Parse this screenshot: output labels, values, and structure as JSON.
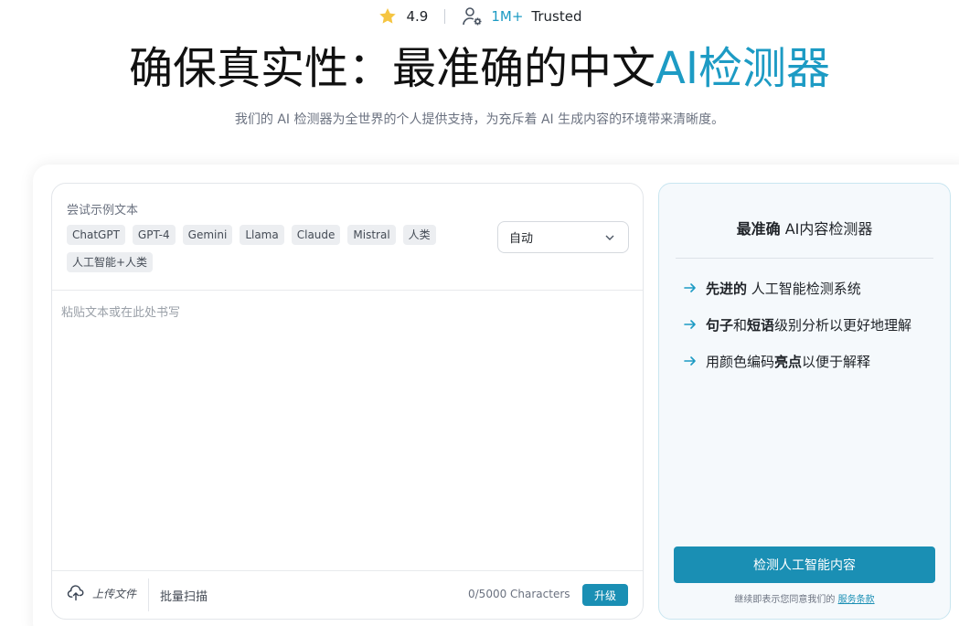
{
  "rating": {
    "score": "4.9",
    "users_count": "1M+",
    "trusted_label": "Trusted"
  },
  "hero": {
    "title_main": "确保真实性：最准确的中文",
    "title_accent": "AI检测器",
    "subtitle": "我们的 AI 检测器为全世界的个人提供支持，为充斥着 AI 生成内容的环境带来清晰度。"
  },
  "editor": {
    "sample_label": "尝试示例文本",
    "samples": [
      "ChatGPT",
      "GPT-4",
      "Gemini",
      "Llama",
      "Claude",
      "Mistral",
      "人类",
      "人工智能+人类"
    ],
    "mode_value": "自动",
    "placeholder": "粘贴文本或在此处书写",
    "upload_label": "上传文件",
    "batch_label": "批量扫描",
    "char_count": "0/5000 Characters",
    "upgrade_label": "升级"
  },
  "side": {
    "title_bold": "最准确",
    "title_rest": " AI内容检测器",
    "features": [
      {
        "parts": [
          {
            "t": "先进的",
            "b": true
          },
          {
            "t": " 人工智能检测系统",
            "b": false
          }
        ]
      },
      {
        "parts": [
          {
            "t": "句子",
            "b": true
          },
          {
            "t": "和",
            "b": false
          },
          {
            "t": "短语",
            "b": true
          },
          {
            "t": "级别分析以更好地理解",
            "b": false
          }
        ]
      },
      {
        "parts": [
          {
            "t": "用颜色编码",
            "b": false
          },
          {
            "t": "亮点",
            "b": true
          },
          {
            "t": "以便于解释",
            "b": false
          }
        ]
      }
    ],
    "detect_label": "检测人工智能内容",
    "terms_text": "继续即表示您同意我们的",
    "terms_link": "服务条款"
  },
  "colors": {
    "accent": "#1d9bc4",
    "button": "#1a8fb4",
    "star": "#f5c542"
  },
  "icons": {
    "rating": "star-icon",
    "users": "user-gear-icon",
    "dropdown": "chevron-down-icon",
    "upload": "cloud-upload-icon",
    "feature": "arrow-right-icon"
  }
}
